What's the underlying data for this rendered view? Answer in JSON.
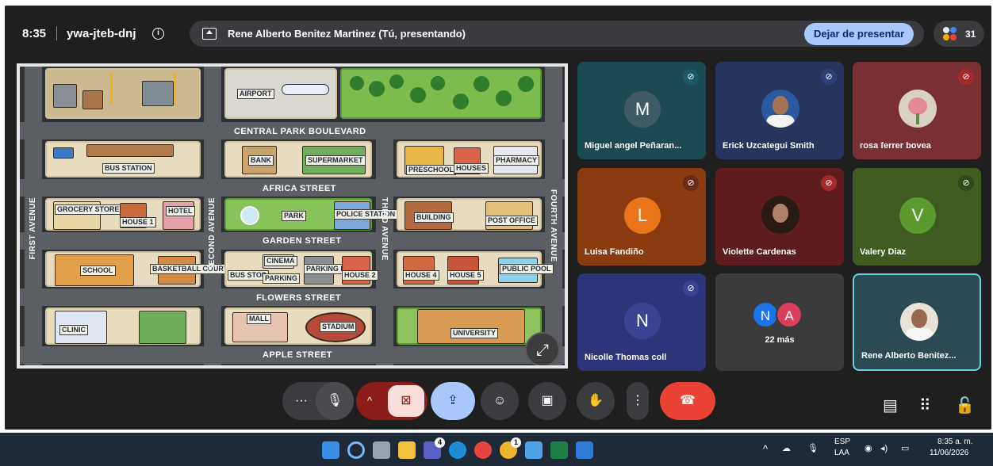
{
  "meeting": {
    "time": "8:35",
    "code": "ywa-jteb-dnj",
    "presenting_text": "Rene Alberto Benitez Martinez (Tú, presentando)",
    "stop_presenting": "Dejar de presentar",
    "participant_count": "31"
  },
  "map": {
    "streets": {
      "central_park": "CENTRAL PARK BOULEVARD",
      "africa": "AFRICA STREET",
      "garden": "GARDEN STREET",
      "flowers": "FLOWERS STREET",
      "apple": "APPLE STREET",
      "first_ave": "FIRST AVENUE",
      "second_ave": "SECOND AVENUE",
      "third_ave": "THIRD AVENUE",
      "fourth_ave": "FOURTH AVENUE"
    },
    "places": {
      "airport": "AIRPORT",
      "bus_station": "BUS STATION",
      "bank": "BANK",
      "supermarket": "SUPERMARKET",
      "preschool": "PRESCHOOL",
      "houses": "HOUSES",
      "pharmacy": "PHARMACY",
      "grocery": "GROCERY STORE",
      "house1": "HOUSE 1",
      "hotel": "HOTEL",
      "park": "PARK",
      "police": "POLICE STATION",
      "building": "BUILDING",
      "post_office": "POST OFFICE",
      "school": "SCHOOL",
      "basketball": "BASKETBALL COURT",
      "bus_stop": "BUS STOP",
      "cinema": "CINEMA",
      "parking": "PARKING",
      "parking_lot": "PARKING LOT",
      "house2": "HOUSE 2",
      "house4": "HOUSE 4",
      "house5": "HOUSE 5",
      "public_pool": "PUBLIC POOL",
      "clinic": "CLINIC",
      "mall": "MALL",
      "stadium": "STADIUM",
      "university": "UNIVERSITY"
    }
  },
  "participants": [
    {
      "name": "Miguel angel Peñaran...",
      "initial": "M",
      "bg": "#1c4a52",
      "avatar_color": "#3f5b64"
    },
    {
      "name": "Erick Uzcategui Smith",
      "initial": "",
      "bg": "#26345e",
      "avatar_color": "#2c5aa0"
    },
    {
      "name": "rosa ferrer bovea",
      "initial": "",
      "bg": "#7a2f35",
      "avatar_color": "#d9d1c4"
    },
    {
      "name": "Luisa Fandiño",
      "initial": "L",
      "bg": "#8a3c10",
      "avatar_color": "#e8751a"
    },
    {
      "name": "Violette Cardenas",
      "initial": "",
      "bg": "#5e1c1f",
      "avatar_color": "#2a1a16"
    },
    {
      "name": "Valery Diaz",
      "initial": "V",
      "bg": "#3f5b20",
      "avatar_color": "#5a9a2e"
    },
    {
      "name": "Nicolle Thomas coll",
      "initial": "N",
      "bg": "#2e347a",
      "avatar_color": "#3a4392"
    },
    {
      "name": "Rene Alberto Benitez...",
      "initial": "",
      "bg": "#2b4a54",
      "avatar_color": "#e9e2d8"
    }
  ],
  "more": {
    "initials": [
      "N",
      "A"
    ],
    "colors": [
      "#1a73e8",
      "#d93e5a"
    ],
    "label": "22 más"
  },
  "taskbar": {
    "badge_teams": "4",
    "badge_chrome": "1",
    "lang_top": "ESP",
    "lang_bottom": "LAA",
    "clock_time": "8:35 a. m.",
    "clock_date": "11/06/2026"
  },
  "colors": {
    "meet_bg": "#1f1f1f",
    "stop_btn": "#a8c7fa",
    "end_call": "#ea4335",
    "active_tile_border": "#6ad0dc"
  }
}
